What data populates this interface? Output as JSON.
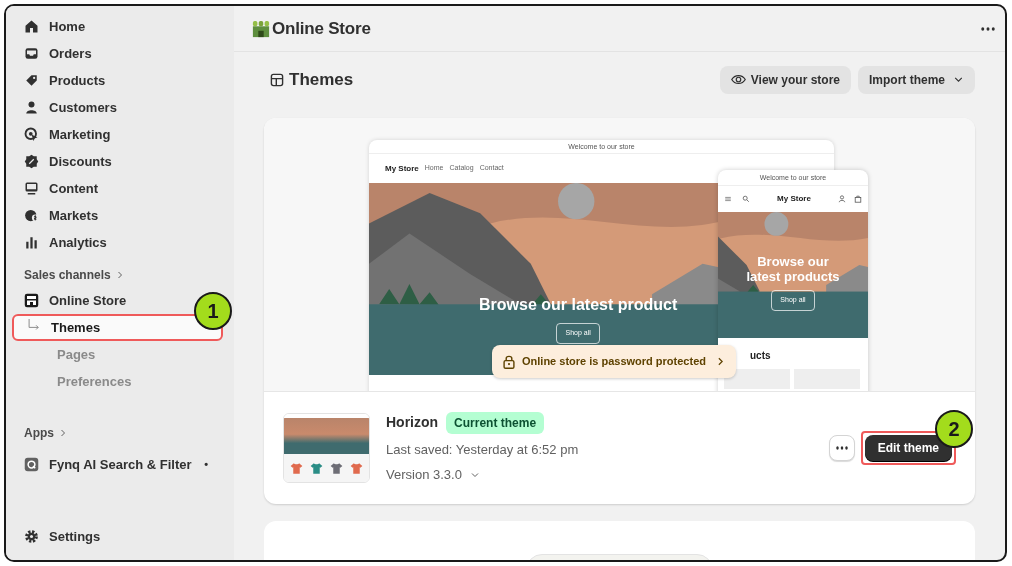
{
  "sidebar": {
    "nav": [
      {
        "label": "Home"
      },
      {
        "label": "Orders"
      },
      {
        "label": "Products"
      },
      {
        "label": "Customers"
      },
      {
        "label": "Marketing"
      },
      {
        "label": "Discounts"
      },
      {
        "label": "Content"
      },
      {
        "label": "Markets"
      },
      {
        "label": "Analytics"
      }
    ],
    "sales_channels": {
      "heading": "Sales channels",
      "channel": {
        "label": "Online Store",
        "children": [
          {
            "label": "Themes",
            "selected": true,
            "highlighted": true
          },
          {
            "label": "Pages",
            "selected": false,
            "highlighted": false
          },
          {
            "label": "Preferences",
            "selected": false,
            "highlighted": false
          }
        ]
      }
    },
    "apps": {
      "heading": "Apps",
      "items": [
        {
          "label": "Fynq AI Search & Filter",
          "marker": "•"
        }
      ]
    },
    "settings": {
      "label": "Settings"
    }
  },
  "header": {
    "title": "Online Store"
  },
  "page": {
    "title": "Themes",
    "actions": [
      {
        "label": "View your store",
        "kind": "view"
      },
      {
        "label": "Import theme",
        "kind": "dropdown"
      }
    ]
  },
  "preview": {
    "desktop": {
      "announcement": "Welcome to our store",
      "brand": "My Store",
      "links": [
        "Home",
        "Catalog",
        "Contact"
      ],
      "hero": "Browse our latest product",
      "cta": "Shop all"
    },
    "mobile": {
      "announcement": "Welcome to our store",
      "brand": "My Store",
      "hero": "Browse our latest products",
      "cta": "Shop all",
      "section": "ucts"
    },
    "notice": "Online store is password protected"
  },
  "theme": {
    "name": "Horizon",
    "badge": "Current theme",
    "saved": "Last saved: Yesterday at 6:52 pm",
    "version": "Version 3.3.0",
    "primary": {
      "label": "Edit theme",
      "highlighted": true
    }
  },
  "annotations": [
    {
      "label": "1"
    },
    {
      "label": "2"
    }
  ]
}
